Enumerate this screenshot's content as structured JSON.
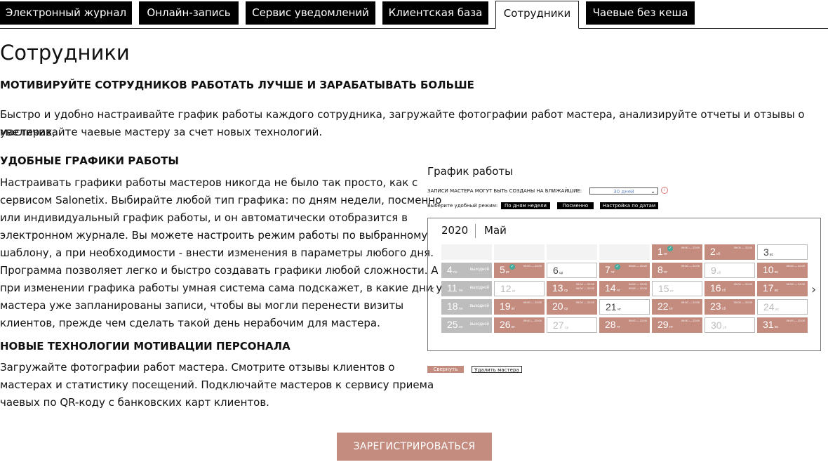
{
  "tabs": [
    "Электронный журнал",
    "Онлайн-запись",
    "Сервис уведомлений",
    "Клиентская база",
    "Сотрудники",
    "Чаевые без кеша"
  ],
  "page_title": "Сотрудники",
  "heading_motivate": "МОТИВИРУЙТЕ СОТРУДНИКОВ РАБОТАТЬ ЛУЧШЕ И ЗАРАБАТЫВАТЬ БОЛЬШЕ",
  "intro_line1": "Быстро и удобно настраивайте график работы каждого сотрудника, загружайте фотографии работ мастера, анализируйте отчеты и отзывы о мастерах,",
  "intro_line2": "увеличивайте чаевые мастеру за счет новых технологий.",
  "heading_schedules": "УДОБНЫЕ ГРАФИКИ РАБОТЫ",
  "schedules_lines": [
    "Настраивать графики работы мастеров никогда не было так просто, как с",
    "сервисом Salonetix. Выбирайте любой тип графика: по дням недели, посменно",
    "или индивидуальный график работы, и он автоматически отобразится в",
    "электронном журнале. Вы можете настроить режим работы по выбранному",
    "шаблону, а при необходимости - внести изменения в параметры любого дня.",
    "Программа позволяет легко и быстро создавать графики любой сложности. А",
    "при изменении графика работы умная система сама подскажет, в какие дни у",
    "мастера уже запланированы записи, чтобы вы могли перенести визиты",
    "клиентов, прежде чем сделать такой день нерабочим для мастера."
  ],
  "heading_tech": "НОВЫЕ ТЕХНОЛОГИИ МОТИВАЦИИ ПЕРСОНАЛА",
  "tech_lines": [
    "Загружайте фотографии работ мастера. Смотрите отзывы клиентов о",
    "мастерах и статистику посещений. Подключайте мастеров к сервису приема",
    "чаевых по QR-коду с банковских карт клиентов."
  ],
  "schedule": {
    "title": "График работы",
    "records_label": "ЗАПИСИ МАСТЕРА МОГУТ БЫТЬ СОЗДАНЫ НА БЛИЖАЙШИЕ:",
    "records_value": "30 дней",
    "mode_label": "Выберите удобный режим:",
    "modes": [
      "По дням недели",
      "Посменно",
      "Настройка по датам"
    ],
    "year": "2020",
    "month": "Май",
    "off_label": "выходной",
    "time_label": "09:00 — 22:00",
    "collapse": "Свернуть",
    "delete_master": "Удалить мастера"
  },
  "calendar": [
    [
      {
        "t": "empty"
      },
      {
        "t": "empty"
      },
      {
        "t": "empty"
      },
      {
        "t": "empty"
      },
      {
        "t": "work",
        "n": "1",
        "d": "пт",
        "ok": true
      },
      {
        "t": "work",
        "n": "2",
        "d": "сб"
      },
      {
        "t": "free",
        "n": "3",
        "d": "вс",
        "dark": true
      }
    ],
    [
      {
        "t": "off",
        "n": "4",
        "d": "пн"
      },
      {
        "t": "work",
        "n": "5",
        "d": "вт",
        "ok": true
      },
      {
        "t": "free",
        "n": "6",
        "d": "ср",
        "dark": true
      },
      {
        "t": "work",
        "n": "7",
        "d": "чт",
        "ok": true
      },
      {
        "t": "work",
        "n": "8",
        "d": "пт"
      },
      {
        "t": "free",
        "n": "9",
        "d": "сб"
      },
      {
        "t": "work",
        "n": "10",
        "d": "вс"
      }
    ],
    [
      {
        "t": "off",
        "n": "11",
        "d": "пн"
      },
      {
        "t": "free",
        "n": "12",
        "d": "вт"
      },
      {
        "t": "work",
        "n": "13",
        "d": "ср",
        "double": true
      },
      {
        "t": "work",
        "n": "14",
        "d": "чт",
        "double": true
      },
      {
        "t": "free",
        "n": "15",
        "d": "пт"
      },
      {
        "t": "work",
        "n": "16",
        "d": "сб"
      },
      {
        "t": "work",
        "n": "17",
        "d": "вс"
      }
    ],
    [
      {
        "t": "off",
        "n": "18",
        "d": "пн"
      },
      {
        "t": "work",
        "n": "19",
        "d": "вт"
      },
      {
        "t": "work",
        "n": "20",
        "d": "ср"
      },
      {
        "t": "free",
        "n": "21",
        "d": "чт",
        "dark": true
      },
      {
        "t": "work",
        "n": "22",
        "d": "пт"
      },
      {
        "t": "work",
        "n": "23",
        "d": "сб"
      },
      {
        "t": "free",
        "n": "24",
        "d": "вс"
      }
    ],
    [
      {
        "t": "off",
        "n": "25",
        "d": "пн"
      },
      {
        "t": "work",
        "n": "26",
        "d": "вт"
      },
      {
        "t": "free",
        "n": "27",
        "d": "ср"
      },
      {
        "t": "work",
        "n": "28",
        "d": "чт"
      },
      {
        "t": "work",
        "n": "29",
        "d": "пт"
      },
      {
        "t": "free",
        "n": "30",
        "d": "сб"
      },
      {
        "t": "work",
        "n": "31",
        "d": "вс"
      }
    ]
  ],
  "register_button": "ЗАРЕГИСТРИРОВАТЬСЯ"
}
